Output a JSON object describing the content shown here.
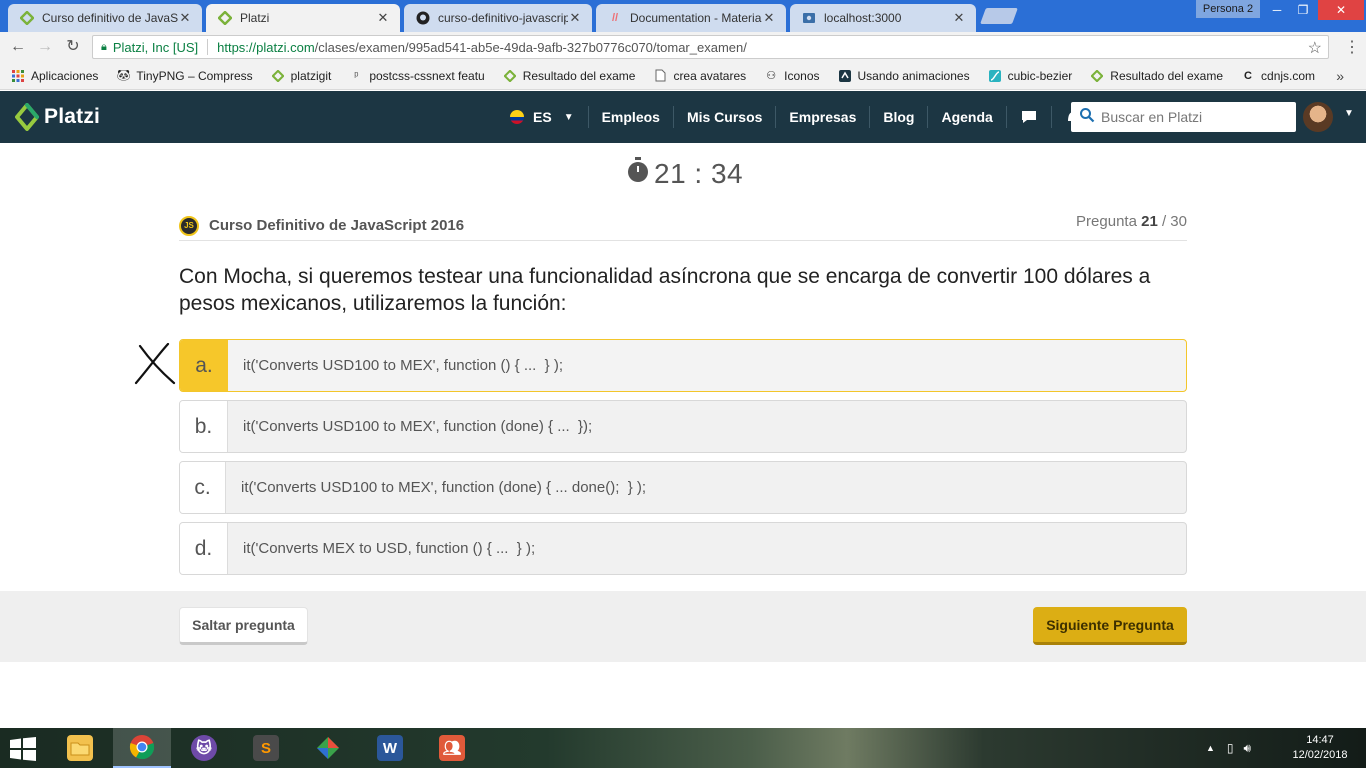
{
  "browser": {
    "tabs": [
      {
        "title": "Curso definitivo de JavaS",
        "active": false
      },
      {
        "title": "Platzi",
        "active": true
      },
      {
        "title": "curso-definitivo-javascrip",
        "active": false
      },
      {
        "title": "Documentation - Materia",
        "active": false
      },
      {
        "title": "localhost:3000",
        "active": false
      }
    ],
    "profile": "Persona 2",
    "address": {
      "secure_label": "Platzi, Inc [US]",
      "url_host": "https://platzi.com",
      "url_path": "/clases/examen/995ad541-ab5e-49da-9afb-327b0776c070/tomar_examen/"
    },
    "bookmarks": [
      "Aplicaciones",
      "TinyPNG – Compress",
      "platzigit",
      "postcss-cssnext featu",
      "Resultado del exame",
      "crea avatares",
      "Iconos",
      "Usando animaciones",
      "cubic-bezier",
      "Resultado del exame",
      "cdnjs.com"
    ],
    "bookmarks_more": "»"
  },
  "header": {
    "logo": "Platzi",
    "lang": "ES",
    "nav": [
      "Empleos",
      "Mis Cursos",
      "Empresas",
      "Blog",
      "Agenda"
    ],
    "search_placeholder": "Buscar en Platzi"
  },
  "exam": {
    "timer": "21 : 34",
    "course_badge": "JS",
    "course": "Curso Definitivo de JavaScript 2016",
    "question_label": "Pregunta",
    "question_current": "21",
    "question_total": "/ 30",
    "question": "Con Mocha, si queremos testear una funcionalidad asíncrona que se encarga de convertir 100 dólares a pesos mexicanos, utilizaremos la función:",
    "options": [
      {
        "letter": "a.",
        "text": "it('Converts USD100 to MEX', function () { ...  } );",
        "selected": true
      },
      {
        "letter": "b.",
        "text": "it('Converts USD100 to MEX', function (done) { ...  });",
        "selected": false
      },
      {
        "letter": "c.",
        "text": "it('Converts USD100 to MEX', function (done) { ... done();  } );",
        "selected": false
      },
      {
        "letter": "d.",
        "text": "it('Converts MEX to USD, function () { ...  } );",
        "selected": false
      }
    ],
    "skip_button": "Saltar pregunta",
    "next_button": "Siguiente Pregunta"
  },
  "taskbar": {
    "apps": [
      "file-explorer",
      "chrome",
      "github-desktop",
      "sublime-text",
      "sourcetree",
      "word",
      "people"
    ],
    "time": "14:47",
    "date": "12/02/2018"
  },
  "colors": {
    "header_bg": "#1c3643",
    "accent_yellow": "#f6c72a",
    "next_button": "#dcae14",
    "platzi_green": "#98ca3f"
  }
}
